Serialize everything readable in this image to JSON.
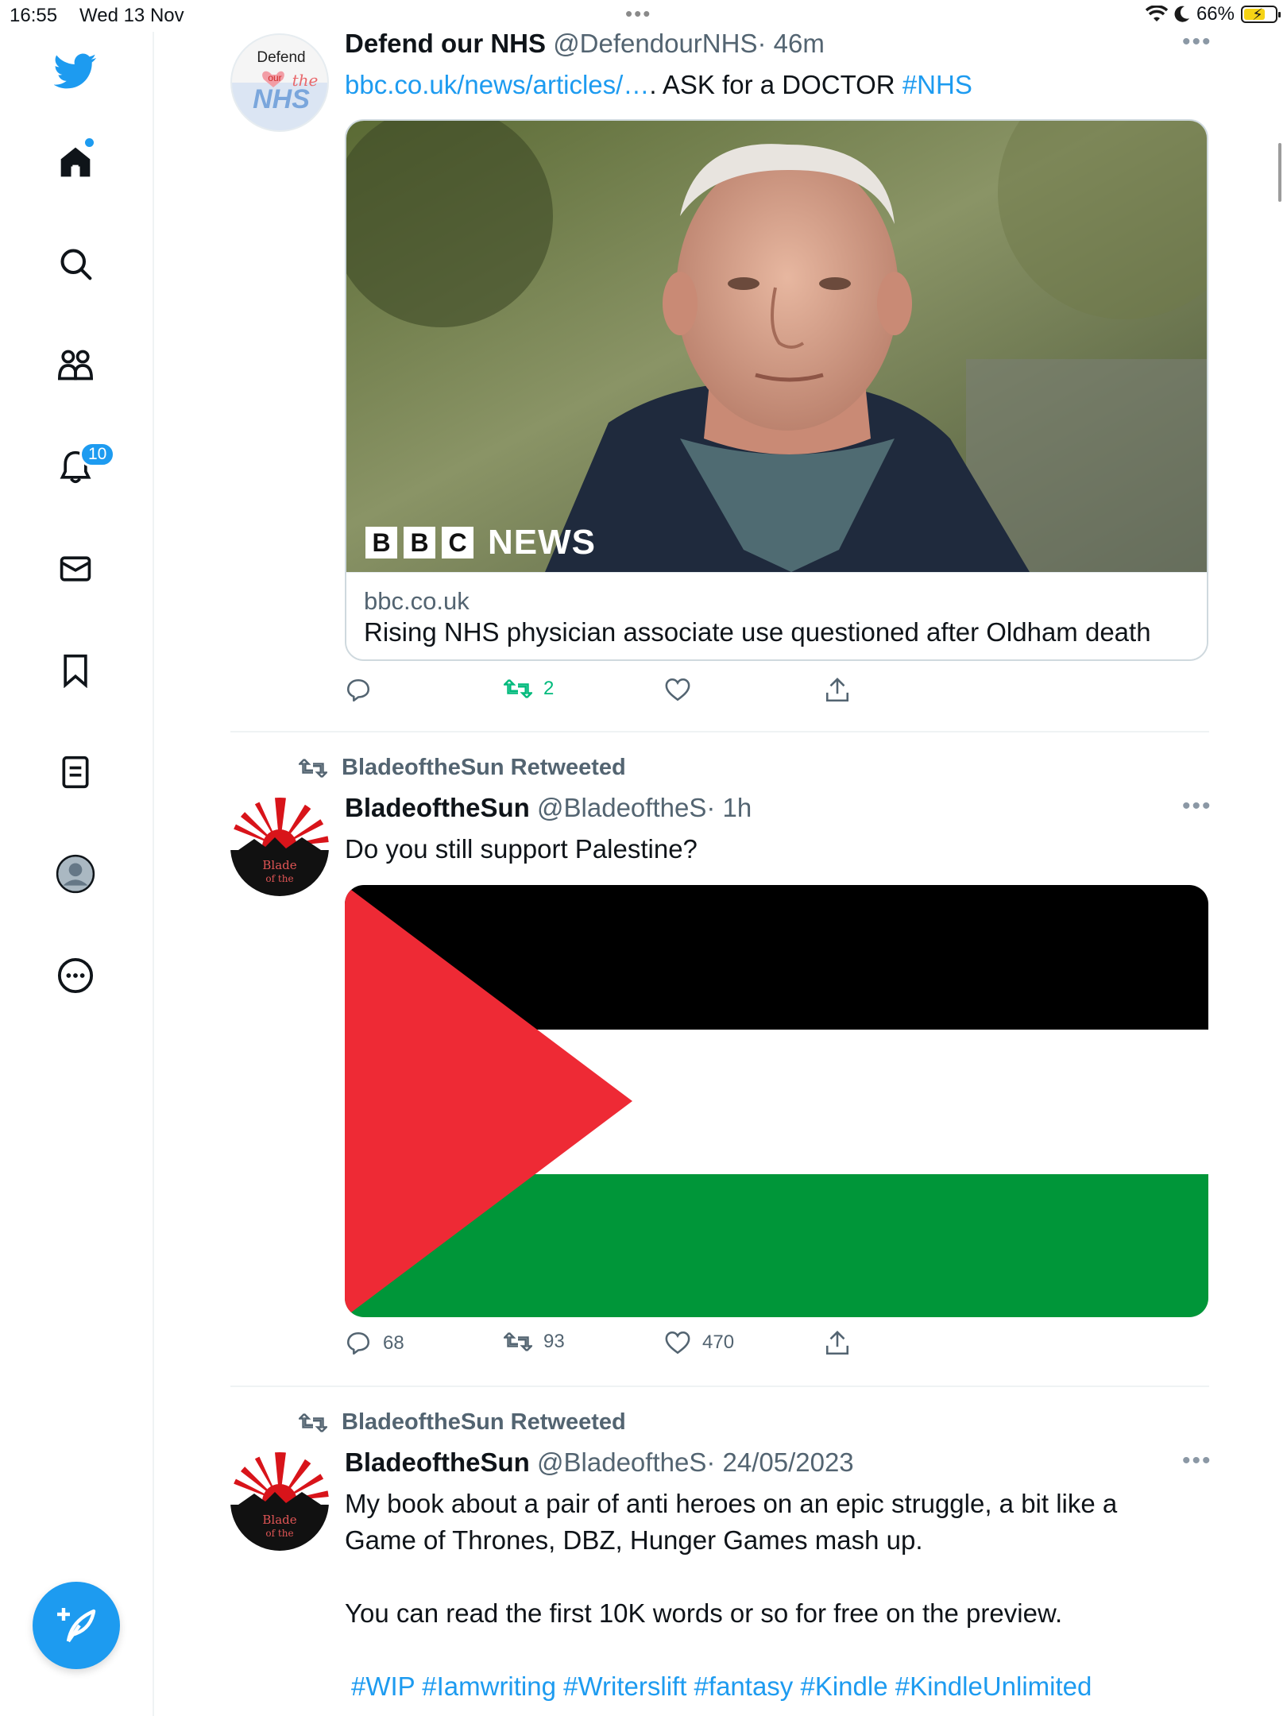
{
  "status_bar": {
    "time": "16:55",
    "date": "Wed 13 Nov",
    "battery": "66%",
    "dots": "•••"
  },
  "sidebar": {
    "icons": [
      "twitter-bird-icon",
      "home-icon",
      "search-icon",
      "communities-icon",
      "bell-icon",
      "mail-icon",
      "bookmark-icon",
      "lists-icon",
      "profile-icon",
      "more-icon"
    ],
    "notification_badge": "10",
    "compose_icon": "compose-icon"
  },
  "colors": {
    "accent": "#1d9bf0",
    "retweet_green": "#00ba7c",
    "secondary_text": "#536471",
    "flag_black": "#000000",
    "flag_white": "#ffffff",
    "flag_green": "#009639",
    "flag_red": "#ee2a35"
  },
  "tweets": [
    {
      "avatar_text": {
        "line1": "Defend",
        "line2": "our",
        "line3": "the",
        "line4": "NHS"
      },
      "name": "Defend our NHS",
      "handle": "@DefendourNHS",
      "time": "· 46m",
      "link_text": "bbc.co.uk/news/articles/…",
      "text_after_link": ". ASK for a DOCTOR ",
      "hashtag": "#NHS",
      "card": {
        "logo_letters": [
          "B",
          "B",
          "C"
        ],
        "logo_word": "NEWS",
        "domain": "bbc.co.uk",
        "title": "Rising NHS physician associate use questioned after Oldham death"
      },
      "actions": {
        "replies": "",
        "retweets": "2",
        "likes": ""
      }
    },
    {
      "retweeted_by": "BladeoftheSun Retweeted",
      "avatar_text": {
        "line1": "Blade",
        "line2": "of the"
      },
      "name": "BladeoftheSun",
      "handle": "@BladeoftheS",
      "time": "· 1h",
      "text": "Do you still support Palestine?",
      "actions": {
        "replies": "68",
        "retweets": "93",
        "likes": "470"
      }
    },
    {
      "retweeted_by": "BladeoftheSun Retweeted",
      "avatar_text": {
        "line1": "Blade",
        "line2": "of the"
      },
      "name": "BladeoftheSun",
      "handle": "@BladeoftheS",
      "time": "· 24/05/2023",
      "text_line1": "My book about a pair of anti heroes on an epic struggle, a bit like a",
      "text_line2": "Game of Thrones, DBZ, Hunger Games mash up.",
      "text_line3": "You can read the first 10K words or so for free on the preview.",
      "hashtags": "#WIP #Iamwriting #Writerslift #fantasy #Kindle #KindleUnlimited"
    }
  ]
}
